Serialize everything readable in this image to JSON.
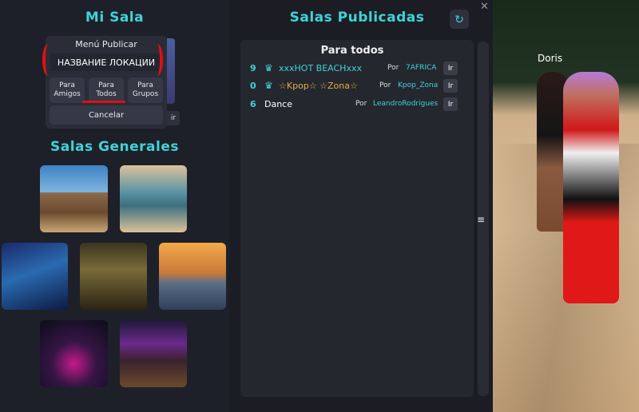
{
  "mi_sala": {
    "title": "Mi Sala",
    "popup": {
      "title": "Menú Publicar",
      "room_name": "НАЗВАНИЕ ЛОКАЦИИ",
      "buttons": [
        {
          "line1": "Para",
          "line2": "Amigos"
        },
        {
          "line1": "Para",
          "line2": "Todos"
        },
        {
          "line1": "Para",
          "line2": "Grupos"
        }
      ],
      "cancel_label": "Cancelar"
    },
    "partial_button_label": "ir"
  },
  "salas_generales": {
    "title": "Salas Generales",
    "thumbnails": [
      "western-town",
      "beach",
      "nightclub",
      "bar",
      "yacht",
      "disco",
      "lounge"
    ]
  },
  "salas_publicadas": {
    "title": "Salas Publicadas",
    "list_header": "Para todos",
    "rooms": [
      {
        "count": "9",
        "crown": true,
        "name": "xxxHOT BEACHxxx",
        "name_color": "#3fd3d8",
        "por": "Por",
        "owner": "7AFRICA",
        "ir": "Ir"
      },
      {
        "count": "0",
        "crown": true,
        "name": "☆Kpop☆ ☆Zona☆",
        "name_color": "#e0b040",
        "por": "Por",
        "owner": "Kpop_Zona",
        "ir": "Ir"
      },
      {
        "count": "6",
        "crown": false,
        "name": "Dance",
        "name_color": "#ffffff",
        "por": "Por",
        "owner": "LeandroRodrigues",
        "ir": "Ir"
      }
    ]
  },
  "scene": {
    "player_name": "Doris"
  },
  "colors": {
    "accent": "#3fd3d8",
    "panel": "#1e2029",
    "annotation_red": "#e01010"
  }
}
